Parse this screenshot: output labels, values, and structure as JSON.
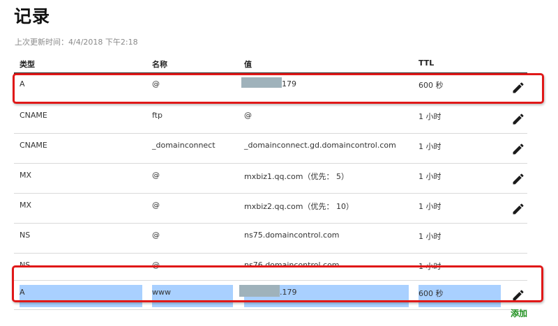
{
  "page": {
    "title": "记录",
    "last_updated": "上次更新时间：4/4/2018 下午2:18",
    "add_label": "添加"
  },
  "table": {
    "headers": {
      "type": "类型",
      "name": "名称",
      "value": "值",
      "ttl": "TTL"
    },
    "rows": [
      {
        "type": "A",
        "name": "@",
        "value": "179",
        "ttl": "600 秒",
        "editable": true
      },
      {
        "type": "CNAME",
        "name": "ftp",
        "value": "@",
        "ttl": "1 小时",
        "editable": true
      },
      {
        "type": "CNAME",
        "name": "_domainconnect",
        "value": "_domainconnect.gd.domaincontrol.com",
        "ttl": "1 小时",
        "editable": true
      },
      {
        "type": "MX",
        "name": "@",
        "value": "mxbiz1.qq.com（优先： 5）",
        "ttl": "1 小时",
        "editable": true
      },
      {
        "type": "MX",
        "name": "@",
        "value": "mxbiz2.qq.com（优先： 10）",
        "ttl": "1 小时",
        "editable": true
      },
      {
        "type": "NS",
        "name": "@",
        "value": "ns75.domaincontrol.com",
        "ttl": "1 小时",
        "editable": false
      },
      {
        "type": "NS",
        "name": "@",
        "value": "ns76.domaincontrol.com",
        "ttl": "1 小时",
        "editable": false
      },
      {
        "type": "A",
        "name": "www",
        "value": ".179",
        "ttl": "600 秒",
        "editable": true
      }
    ]
  },
  "colors": {
    "annotation_red": "#e01818",
    "selection_blue": "#a9d0ff",
    "redaction_gray": "#9fb2bb",
    "add_link_green": "#1b8e1b"
  },
  "icons": {
    "edit": "pencil-icon"
  }
}
